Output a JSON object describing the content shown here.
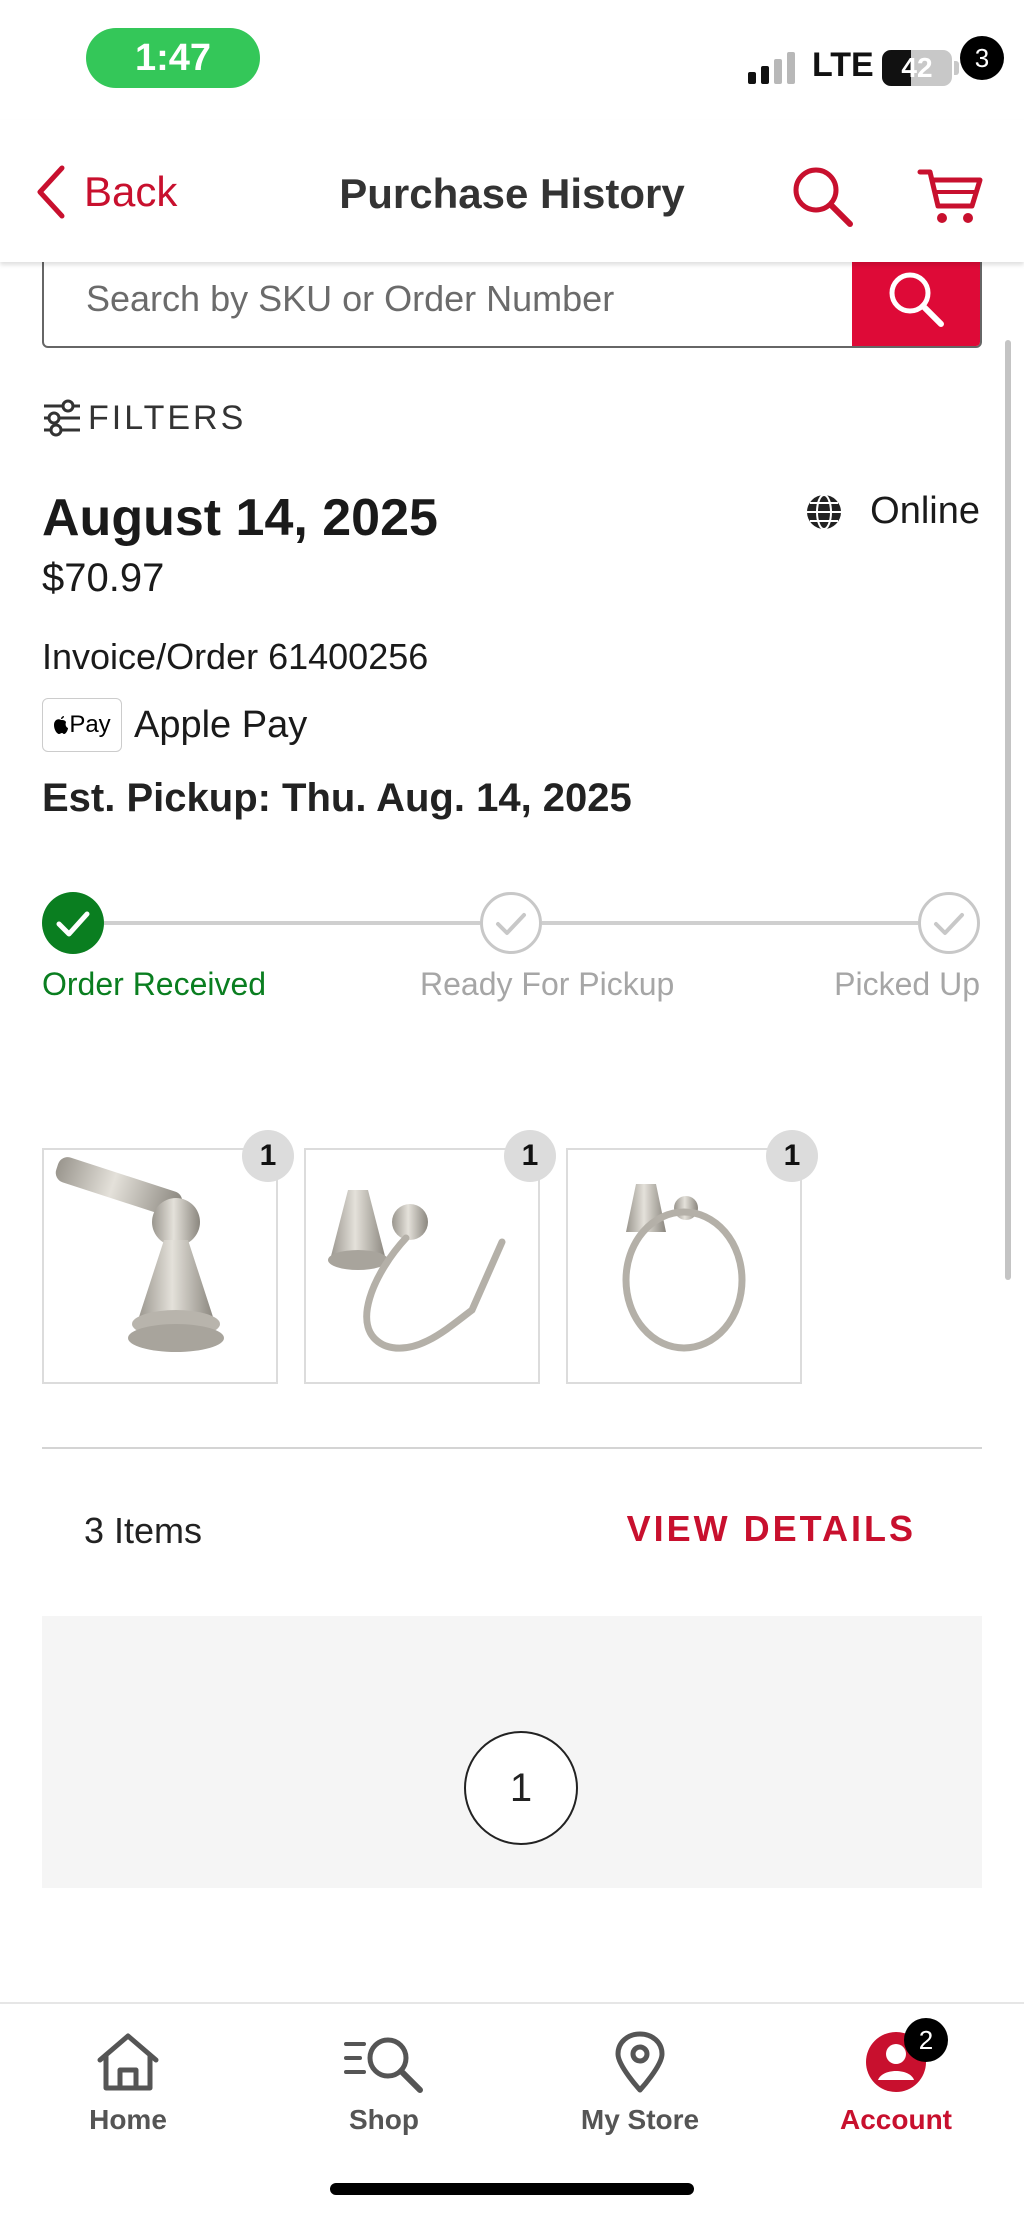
{
  "status_bar": {
    "time": "1:47",
    "network": "LTE",
    "battery_level": "42",
    "signal_bars_filled": 2,
    "signal_bars_total": 4
  },
  "header": {
    "back_label": "Back",
    "title": "Purchase History",
    "cart_count": "3"
  },
  "search": {
    "placeholder": "Search by SKU or Order Number",
    "value": ""
  },
  "filters": {
    "label": "FILTERS"
  },
  "order": {
    "date": "August 14, 2025",
    "channel": "Online",
    "total": "$70.97",
    "invoice": "Invoice/Order 61400256",
    "payment_logo": " Pay",
    "payment_method": "Apple Pay",
    "est_pickup": "Est. Pickup: Thu. Aug. 14, 2025",
    "tracker": [
      {
        "label": "Order Received",
        "status": "complete"
      },
      {
        "label": "Ready For Pickup",
        "status": "pending"
      },
      {
        "label": "Picked Up",
        "status": "pending"
      }
    ],
    "items": [
      {
        "product": "towel-bar",
        "qty": "1"
      },
      {
        "product": "toilet-paper-holder",
        "qty": "1"
      },
      {
        "product": "towel-ring",
        "qty": "1"
      }
    ],
    "items_count": "3 Items",
    "view_details_label": "VIEW DETAILS"
  },
  "pagination": {
    "current_page": "1"
  },
  "tab_bar": {
    "tabs": [
      {
        "label": "Home",
        "icon": "home-icon"
      },
      {
        "label": "Shop",
        "icon": "shop-search-icon"
      },
      {
        "label": "My Store",
        "icon": "location-pin-icon"
      },
      {
        "label": "Account",
        "icon": "account-icon"
      }
    ],
    "active": "Account",
    "account_badge": "2"
  },
  "colors": {
    "brand_red": "#c8102e",
    "search_red": "#de0a37",
    "complete_green": "#0a7e20",
    "time_pill_green": "#34c759"
  }
}
